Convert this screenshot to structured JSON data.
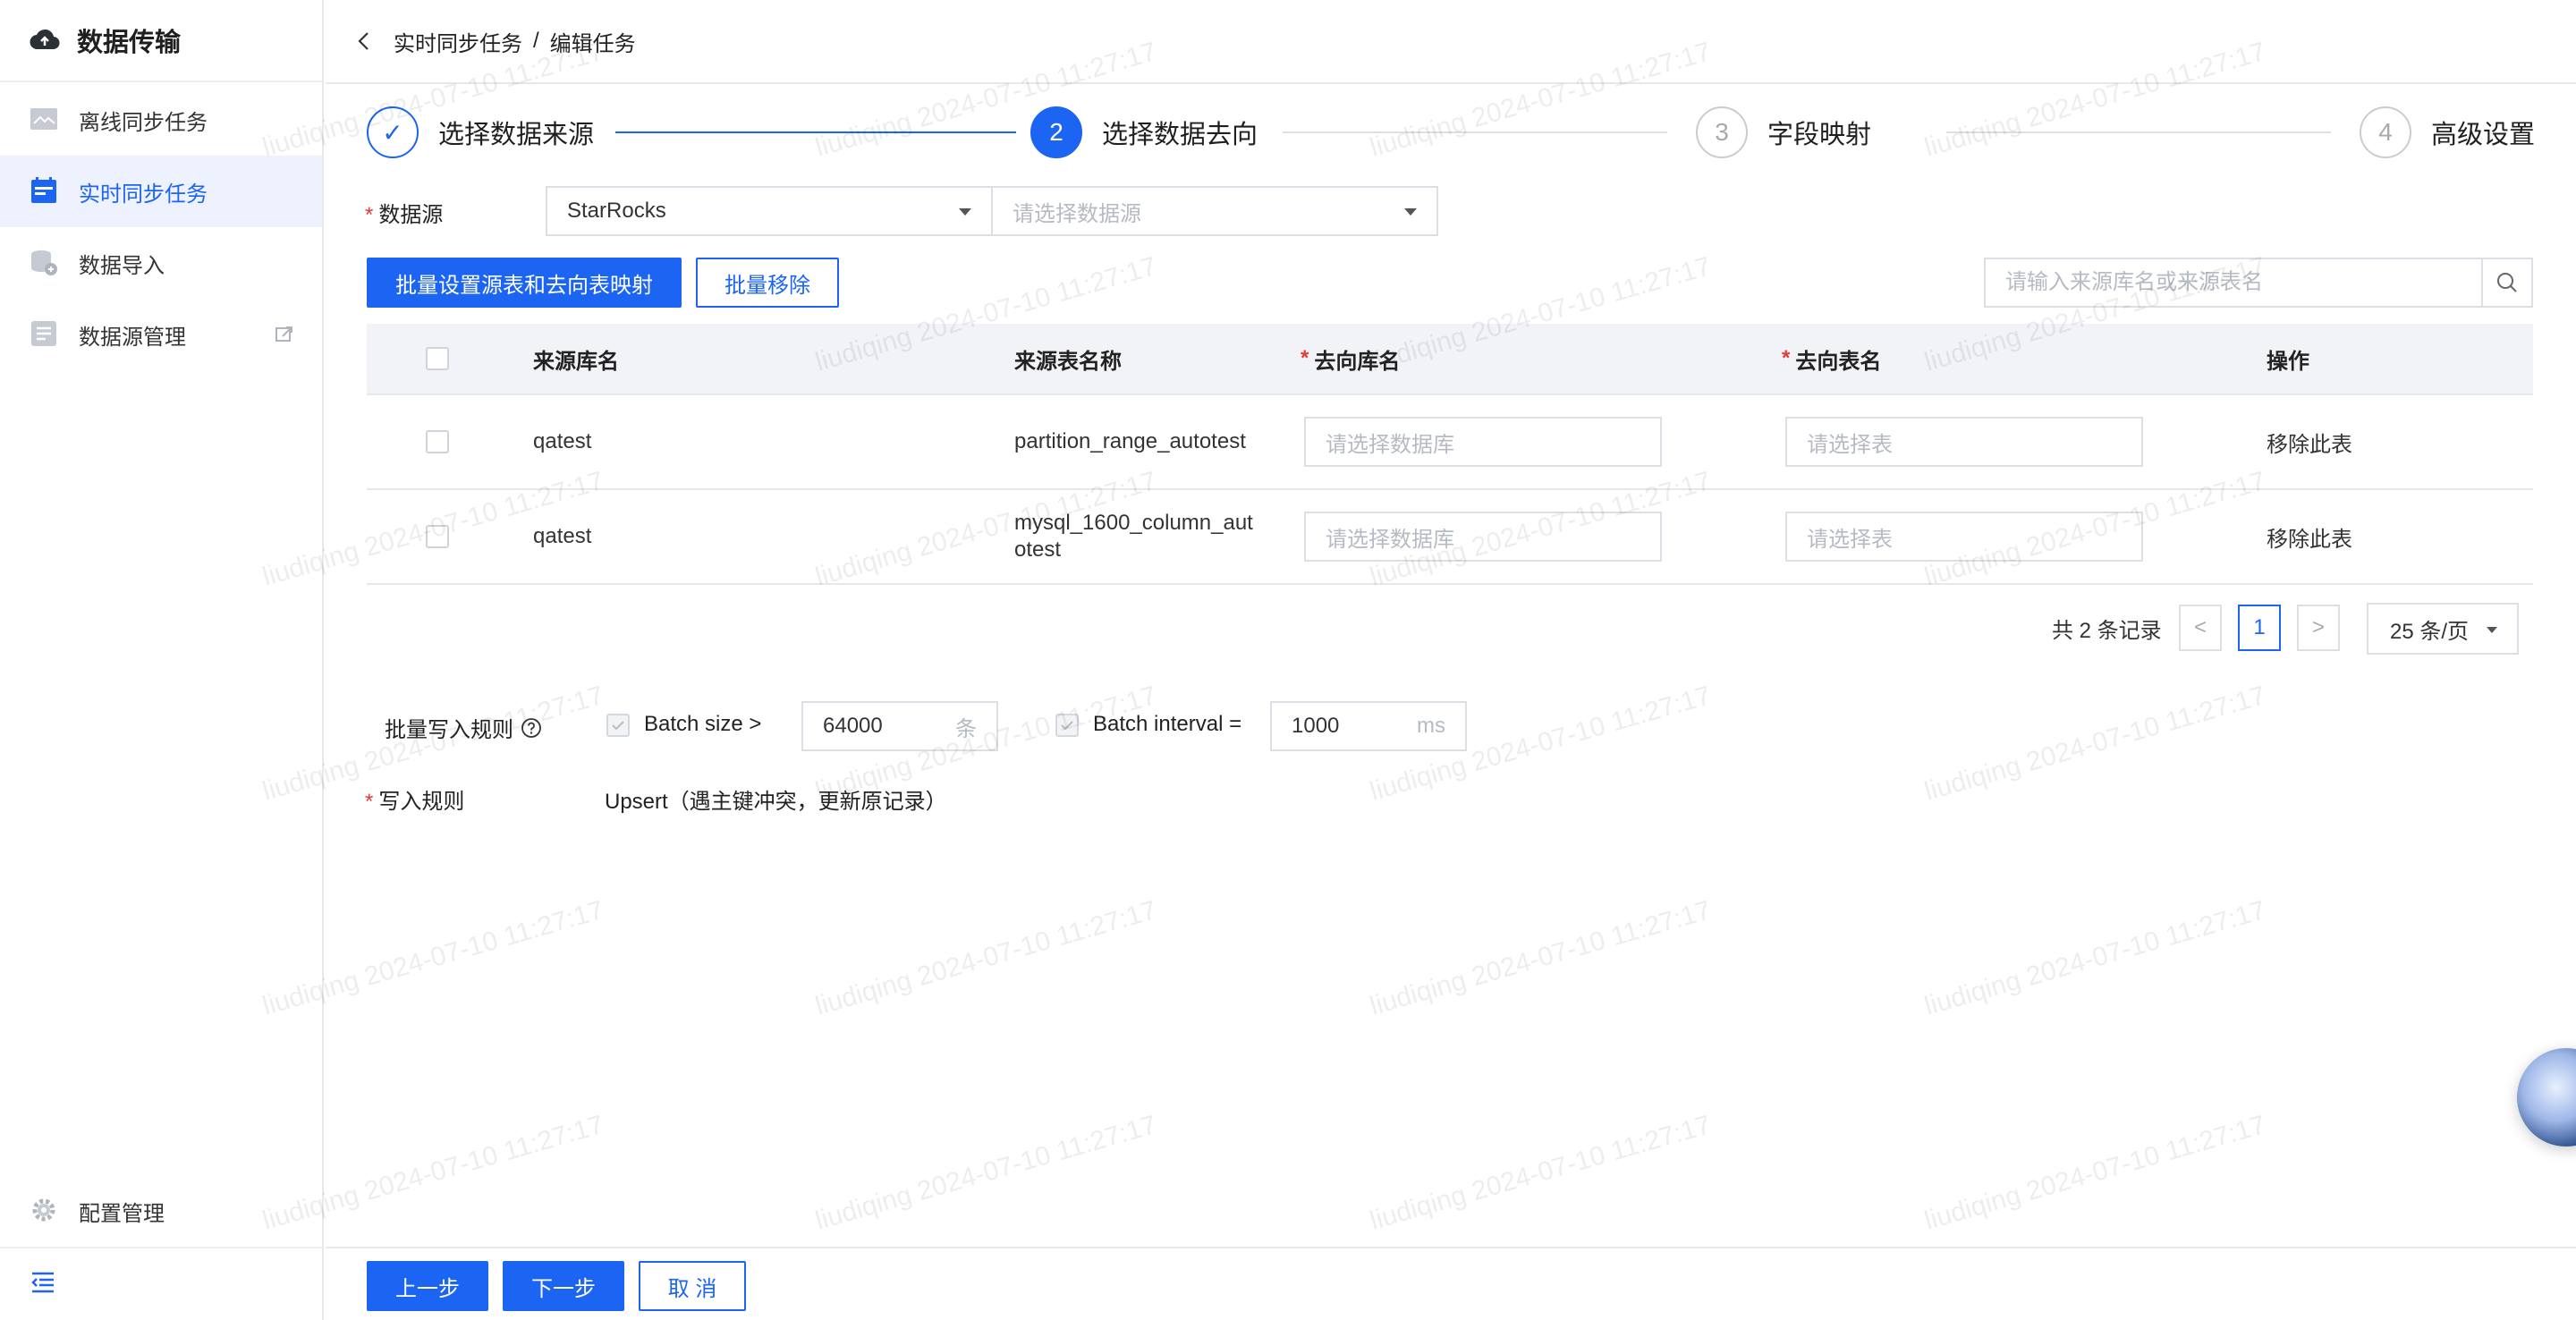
{
  "app": {
    "title": "数据传输"
  },
  "sidebar": {
    "items": [
      {
        "label": "离线同步任务",
        "icon": "offline-sync-icon"
      },
      {
        "label": "实时同步任务",
        "icon": "realtime-sync-icon",
        "active": true
      },
      {
        "label": "数据导入",
        "icon": "data-import-icon"
      },
      {
        "label": "数据源管理",
        "icon": "datasource-manage-icon"
      }
    ],
    "bottom": {
      "label": "配置管理",
      "icon": "gear-icon"
    }
  },
  "breadcrumb": {
    "parent": "实时同步任务",
    "separator": "/",
    "current": "编辑任务"
  },
  "steps": [
    {
      "number": "✓",
      "label": "选择数据来源",
      "state": "done"
    },
    {
      "number": "2",
      "label": "选择数据去向",
      "state": "current"
    },
    {
      "number": "3",
      "label": "字段映射",
      "state": "pending"
    },
    {
      "number": "4",
      "label": "高级设置",
      "state": "pending"
    }
  ],
  "datasource": {
    "label": "数据源",
    "type_value": "StarRocks",
    "source_placeholder": "请选择数据源"
  },
  "actions": {
    "batch_map_label": "批量设置源表和去向表映射",
    "batch_remove_label": "批量移除"
  },
  "search": {
    "placeholder": "请输入来源库名或来源表名"
  },
  "table": {
    "headers": {
      "source_db": "来源库名",
      "source_table": "来源表名称",
      "target_db": "去向库名",
      "target_table": "去向表名",
      "ops": "操作"
    },
    "rows": [
      {
        "source_db": "qatest",
        "source_table": "partition_range_autotest",
        "target_db_placeholder": "请选择数据库",
        "target_table_placeholder": "请选择表",
        "op": "移除此表"
      },
      {
        "source_db": "qatest",
        "source_table": "mysql_1600_column_autotest",
        "target_db_placeholder": "请选择数据库",
        "target_table_placeholder": "请选择表",
        "op": "移除此表"
      }
    ]
  },
  "pagination": {
    "total_text": "共 2 条记录",
    "prev": "<",
    "current": "1",
    "next": ">",
    "page_size": "25 条/页"
  },
  "batch_rule": {
    "label": "批量写入规则",
    "size_label": "Batch size >",
    "size_value": "64000",
    "size_unit": "条",
    "interval_label": "Batch interval =",
    "interval_value": "1000",
    "interval_unit": "ms"
  },
  "write_rule": {
    "label": "写入规则",
    "value": "Upsert（遇主键冲突，更新原记录）"
  },
  "footer": {
    "prev_label": "上一步",
    "next_label": "下一步",
    "cancel_label": "取 消"
  },
  "watermark": {
    "text": "liudiqing 2024-07-10 11:27:17"
  },
  "colors": {
    "primary": "#1c64f2",
    "required": "#e53935",
    "active_bg": "#edf2fe"
  }
}
